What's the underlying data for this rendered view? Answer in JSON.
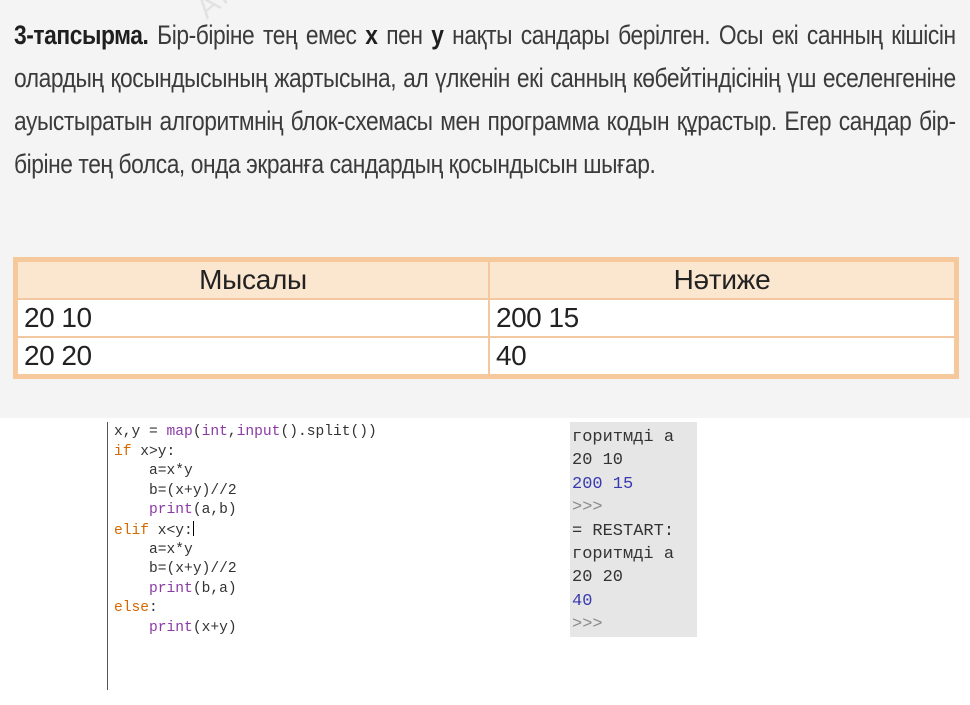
{
  "task": {
    "label": "3-тапсырма.",
    "text_1": "Бір-біріне тең емес",
    "var_x": "x",
    "text_2": "пен",
    "var_y": "y",
    "text_3": "нақты сандары берілген. Осы екі санның кішісін олардың қосындысының жартысына, ал үлкенін екі санның көбейтіндісінің үш еселенгеніне ауыстыратын алгоритмнің блок-схемасы мен программа кодын құрастыр. Егер сандар бір-біріне тең болса, онда экранға сандардың қосындысын шығар."
  },
  "watermark": "Атамұра",
  "example_table": {
    "headers": [
      "Мысалы",
      "Нәтиже"
    ],
    "rows": [
      [
        "20 10",
        "200 15"
      ],
      [
        "20 20",
        "40"
      ]
    ]
  },
  "code": [
    "x,y = map(int,input().split())",
    "if x>y:",
    "    a=x*y",
    "    b=(x+y)//2",
    "    print(a,b)",
    "elif x<y:",
    "    a=x*y",
    "    b=(x+y)//2",
    "    print(b,a)",
    "else:",
    "    print(x+y)"
  ],
  "shell": [
    "горитмді а",
    "20 10",
    "200 15",
    ">>>",
    "= RESTART:",
    "горитмді а",
    "20 20",
    "40",
    ">>>"
  ],
  "colors": {
    "table_border": "#f6c99c",
    "table_header_bg": "#fbe6cf",
    "keyword": "#d46a00",
    "builtin": "#8b3aa6",
    "shell_output": "#3a3ab0"
  }
}
